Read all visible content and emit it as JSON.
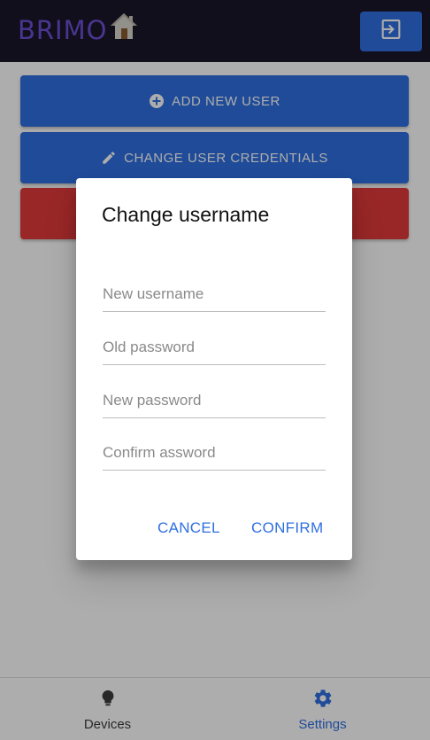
{
  "header": {
    "logo_text": "BRIMO",
    "logo_icon": "house-icon",
    "logout_icon": "logout-icon"
  },
  "actions": {
    "add_user_label": "ADD NEW USER",
    "add_user_icon": "add-circle-icon",
    "change_credentials_label": "CHANGE USER CREDENTIALS",
    "change_credentials_icon": "pencil-icon"
  },
  "dialog": {
    "title": "Change username",
    "fields": {
      "new_username_placeholder": "New username",
      "old_password_placeholder": "Old password",
      "new_password_placeholder": "New password",
      "confirm_password_placeholder": "Confirm assword"
    },
    "cancel_label": "CANCEL",
    "confirm_label": "CONFIRM"
  },
  "bottom_nav": {
    "items": [
      {
        "label": "Devices",
        "icon": "lightbulb-icon",
        "active": false
      },
      {
        "label": "Settings",
        "icon": "gear-icon",
        "active": true
      }
    ]
  },
  "colors": {
    "header_bg": "#1a1728",
    "brand_purple": "#6d4fd6",
    "primary": "#2f6fe0",
    "danger": "#e23a3a"
  }
}
